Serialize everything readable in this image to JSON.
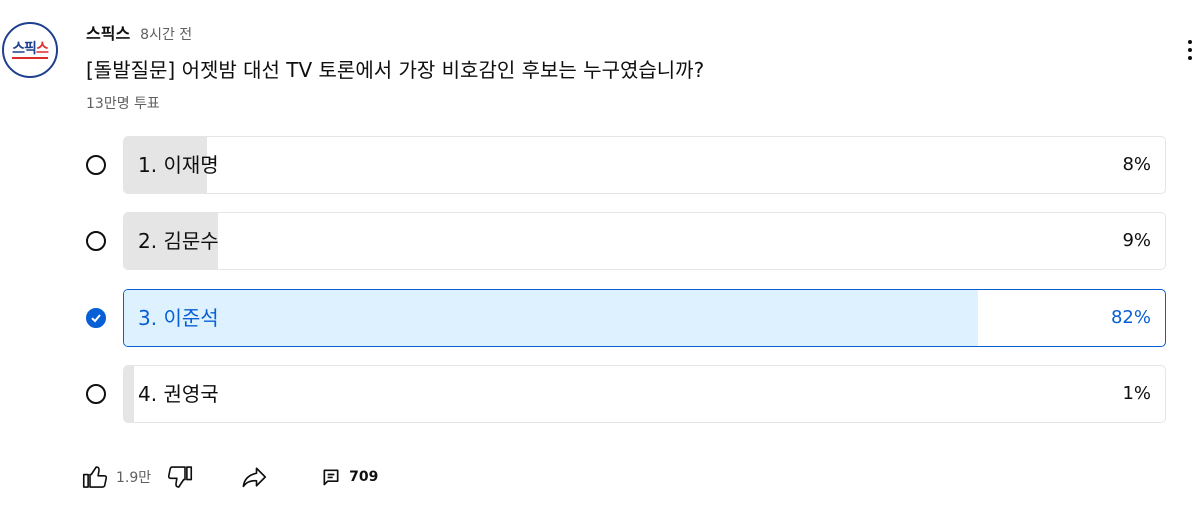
{
  "post": {
    "avatar_text_a": "스픽",
    "avatar_text_b": "스",
    "channel": "스픽스",
    "time": "8시간 전",
    "question": "[돌발질문] 어젯밤 대선 TV 토론에서 가장 비호감인 후보는 누구였습니까?",
    "votes": "13만명 투표"
  },
  "poll": {
    "options": [
      {
        "label": "1. 이재명",
        "percent_text": "8%",
        "percent": 8,
        "selected": false
      },
      {
        "label": "2. 김문수",
        "percent_text": "9%",
        "percent": 9,
        "selected": false
      },
      {
        "label": "3. 이준석",
        "percent_text": "82%",
        "percent": 82,
        "selected": true
      },
      {
        "label": "4. 권영국",
        "percent_text": "1%",
        "percent": 1,
        "selected": false
      }
    ]
  },
  "actions": {
    "likes": "1.9만",
    "comments": "709"
  },
  "colors": {
    "accent": "#065fd4",
    "selected_fill": "#def1ff",
    "bar_fill": "#e5e5e5",
    "secondary_text": "#606060"
  },
  "icons": [
    "thumbs-up-icon",
    "thumbs-down-icon",
    "share-icon",
    "comment-icon",
    "more-vert-icon",
    "check-icon"
  ]
}
